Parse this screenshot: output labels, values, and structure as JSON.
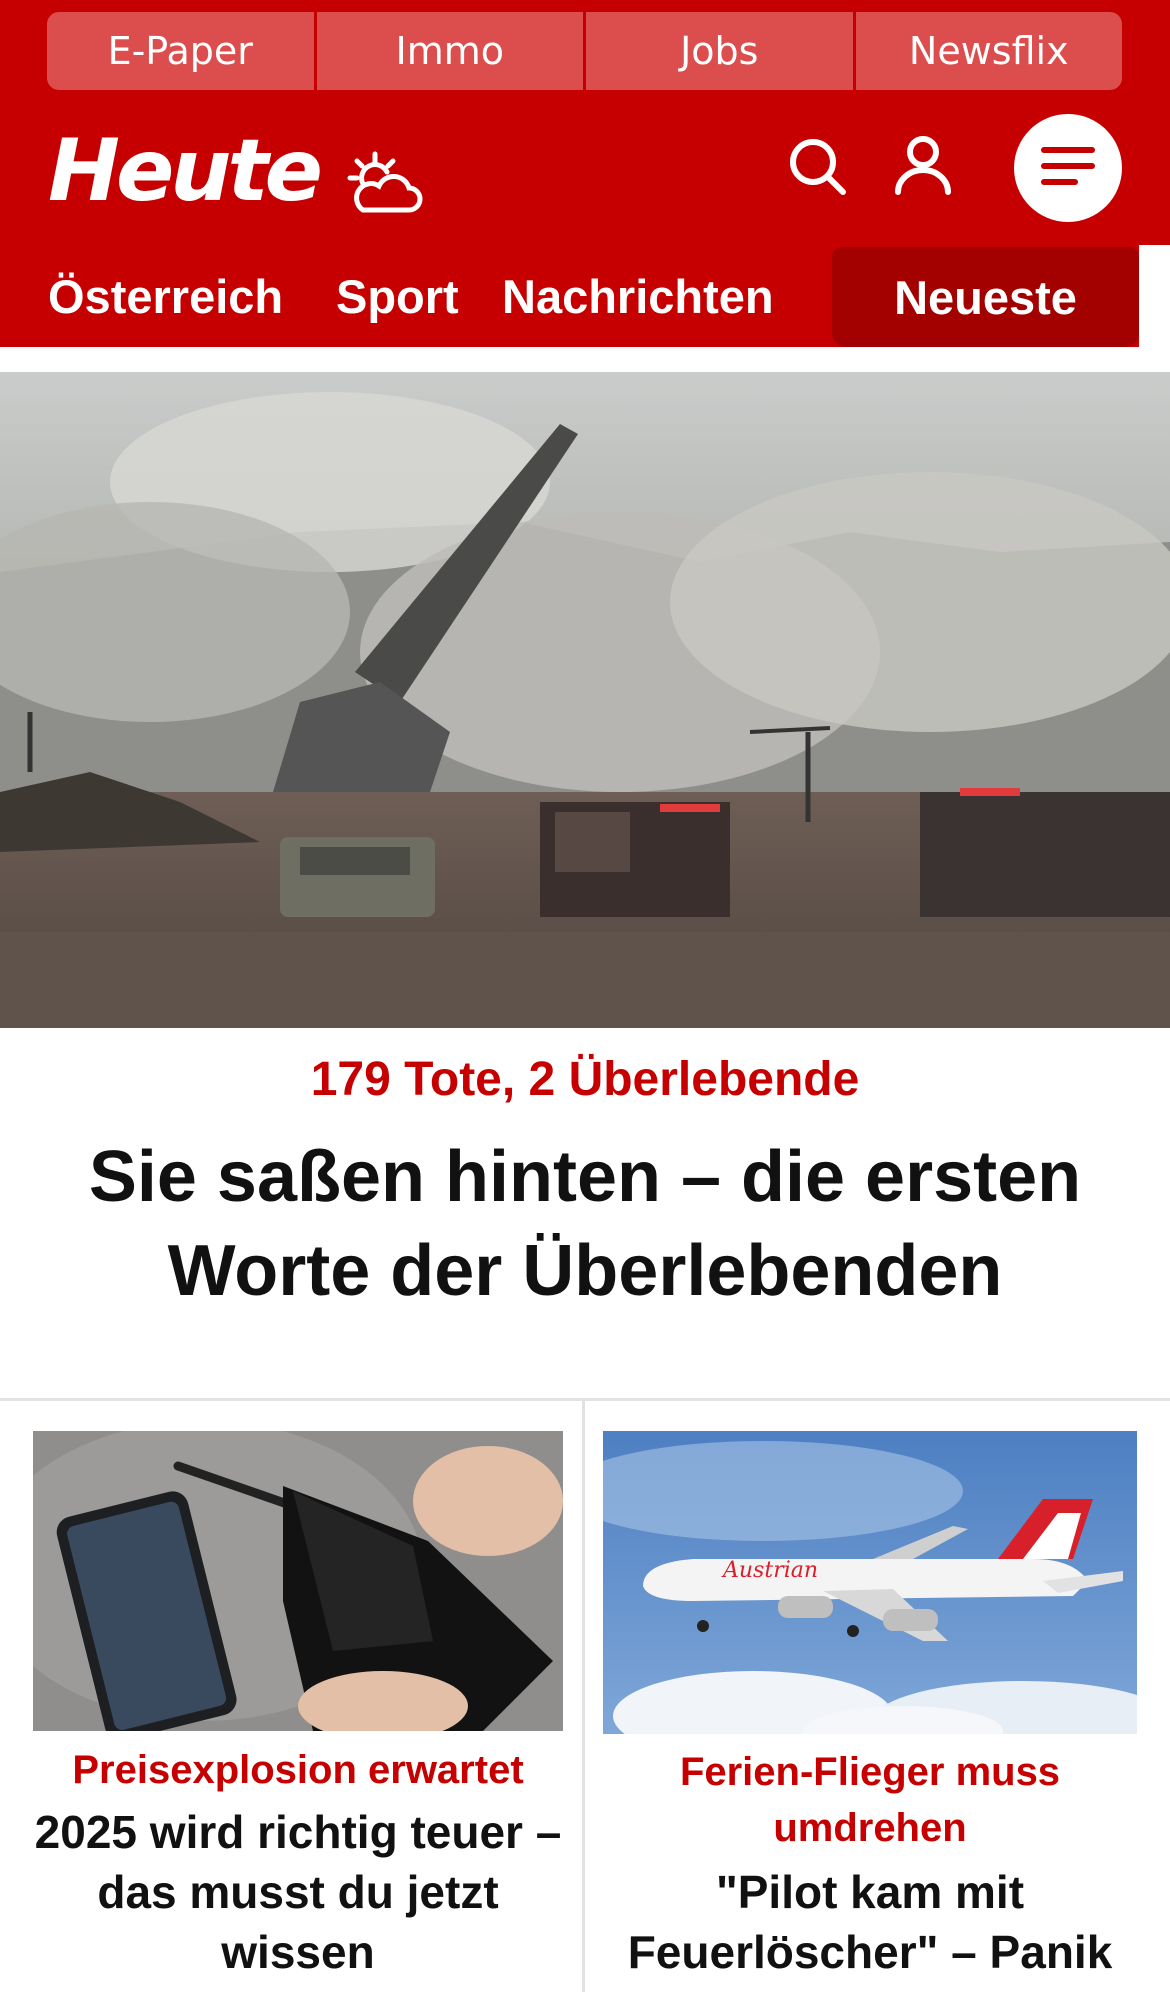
{
  "top_links": [
    "E-Paper",
    "Immo",
    "Jobs",
    "Newsflix"
  ],
  "brand": {
    "logo": "Heute"
  },
  "icons": {
    "weather": "weather-sun-cloud-icon",
    "search": "search-icon",
    "user": "user-icon",
    "menu": "menu-icon"
  },
  "nav": {
    "items": [
      "Österreich",
      "Sport",
      "Nachrichten"
    ],
    "active": "Neueste"
  },
  "hero": {
    "kicker": "179 Tote, 2 Überlebende",
    "title": "Sie saßen hinten – die ersten Worte der Überlebenden"
  },
  "cards": [
    {
      "kicker": "Preisexplosion erwartet",
      "title": "2025 wird richtig teuer – das musst du jetzt wissen"
    },
    {
      "kicker": "Ferien-Flieger muss umdrehen",
      "title": "\"Pilot kam mit Feuerlöscher\" – Panik"
    }
  ],
  "colors": {
    "brand_red": "#c60000",
    "active_tab": "#a30000",
    "top_link_bg": "#dc4d4d"
  }
}
